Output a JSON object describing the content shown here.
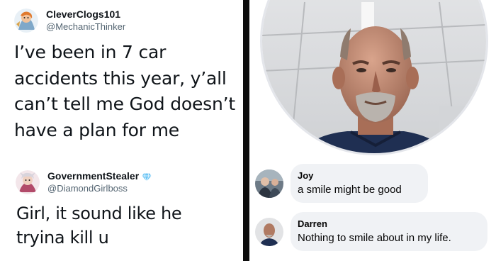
{
  "tweets": [
    {
      "display_name": "CleverClogs101",
      "handle": "@MechanicThinker",
      "text": "I’ve been in 7 car accidents this year, y’all can’t tell me God doesn’t have a plan for me",
      "avatar_icon": "cartoon-avatar-icon"
    },
    {
      "display_name": "GovernmentStealer",
      "handle": "@DiamondGirlboss",
      "text": "Girl, it sound like he tryina kill u",
      "avatar_icon": "cartoon-avatar-icon",
      "badge_icon": "diamond-icon",
      "badge_color": "#6ec6f5"
    }
  ],
  "profile": {
    "photo_icon": "man-selfie-photo"
  },
  "comments": [
    {
      "author": "Joy",
      "text": "a smile might be good"
    },
    {
      "author": "Darren",
      "text": "Nothing to smile about in my life."
    }
  ],
  "colors": {
    "divider": "#0d0d0d",
    "bubble_bg": "#f0f2f5",
    "handle_gray": "#536471"
  }
}
